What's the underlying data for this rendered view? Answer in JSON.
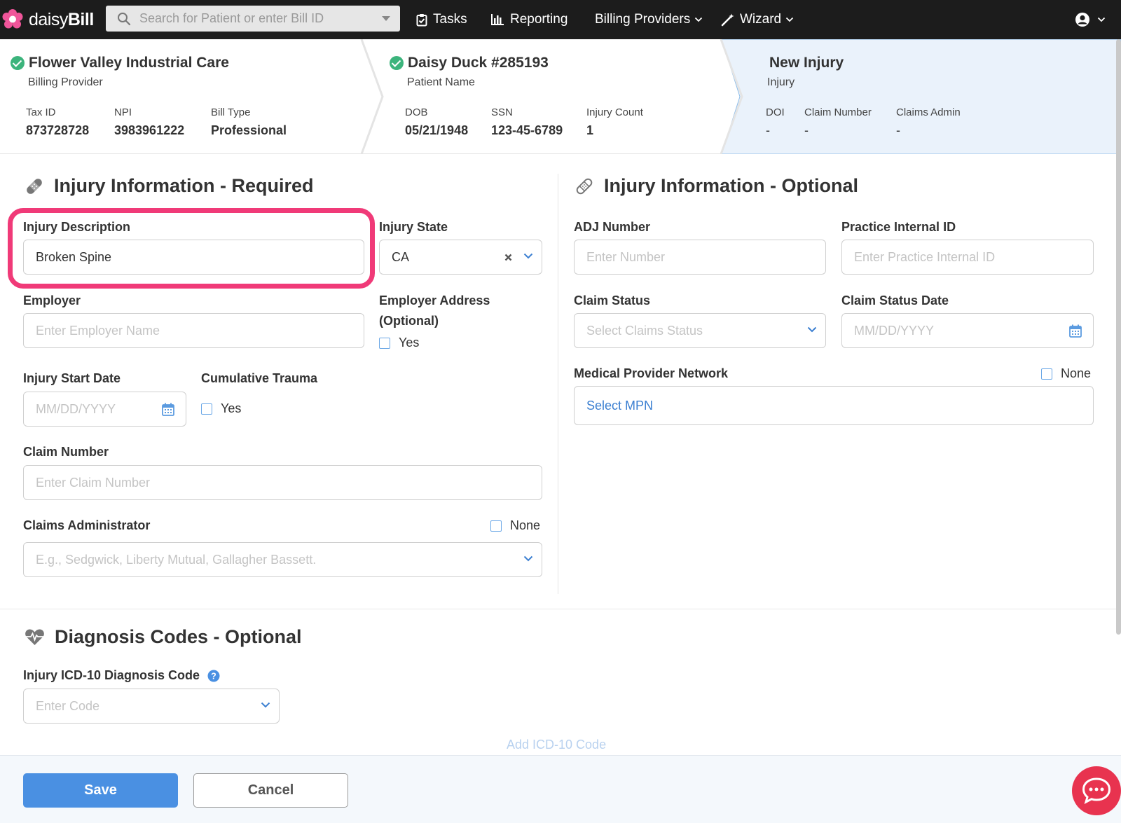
{
  "app": {
    "brand_regular": "daisy",
    "brand_bold": "Bill"
  },
  "search": {
    "placeholder": "Search for Patient or enter Bill ID"
  },
  "nav": {
    "tasks": "Tasks",
    "reporting": "Reporting",
    "billing_providers": "Billing Providers",
    "wizard": "Wizard"
  },
  "header": {
    "provider": {
      "title": "Flower Valley Industrial Care",
      "subtitle": "Billing Provider",
      "fields": [
        {
          "label": "Tax ID",
          "value": "873728728"
        },
        {
          "label": "NPI",
          "value": "3983961222"
        },
        {
          "label": "Bill Type",
          "value": "Professional"
        }
      ]
    },
    "patient": {
      "title": "Daisy Duck #285193",
      "subtitle": "Patient Name",
      "fields": [
        {
          "label": "DOB",
          "value": "05/21/1948"
        },
        {
          "label": "SSN",
          "value": "123-45-6789"
        },
        {
          "label": "Injury Count",
          "value": "1"
        }
      ]
    },
    "injury": {
      "title": "New Injury",
      "subtitle": "Injury",
      "fields": [
        {
          "label": "DOI",
          "value": "-"
        },
        {
          "label": "Claim Number",
          "value": "-"
        },
        {
          "label": "Claims Admin",
          "value": "-"
        }
      ]
    }
  },
  "required": {
    "title": "Injury Information - Required",
    "injury_description": {
      "label": "Injury Description",
      "value": "Broken Spine"
    },
    "injury_state": {
      "label": "Injury State",
      "value": "CA"
    },
    "employer": {
      "label": "Employer",
      "placeholder": "Enter Employer Name"
    },
    "employer_address": {
      "label_line1": "Employer Address",
      "label_line2": "(Optional)",
      "checkbox": "Yes"
    },
    "injury_start_date": {
      "label": "Injury Start Date",
      "placeholder": "MM/DD/YYYY"
    },
    "cumulative_trauma": {
      "label": "Cumulative Trauma",
      "checkbox": "Yes"
    },
    "claim_number": {
      "label": "Claim Number",
      "placeholder": "Enter Claim Number"
    },
    "claims_administrator": {
      "label": "Claims Administrator",
      "none": "None",
      "placeholder": "E.g., Sedgwick, Liberty Mutual, Gallagher Bassett."
    }
  },
  "optional": {
    "title": "Injury Information - Optional",
    "adj_number": {
      "label": "ADJ Number",
      "placeholder": "Enter Number"
    },
    "practice_internal_id": {
      "label": "Practice Internal ID",
      "placeholder": "Enter Practice Internal ID"
    },
    "claim_status": {
      "label": "Claim Status",
      "placeholder": "Select Claims Status"
    },
    "claim_status_date": {
      "label": "Claim Status Date",
      "placeholder": "MM/DD/YYYY"
    },
    "mpn": {
      "label": "Medical Provider Network",
      "none": "None",
      "link": "Select MPN"
    }
  },
  "diagnosis": {
    "title": "Diagnosis Codes - Optional",
    "icd_label": "Injury ICD-10 Diagnosis Code",
    "icd_placeholder": "Enter Code",
    "add_link": "Add ICD-10 Code"
  },
  "footer": {
    "save": "Save",
    "cancel": "Cancel"
  },
  "colors": {
    "accent": "#4a90e2",
    "highlight": "#f03a78",
    "success": "#3cb47c",
    "nav_bg": "#1c1c1c"
  }
}
